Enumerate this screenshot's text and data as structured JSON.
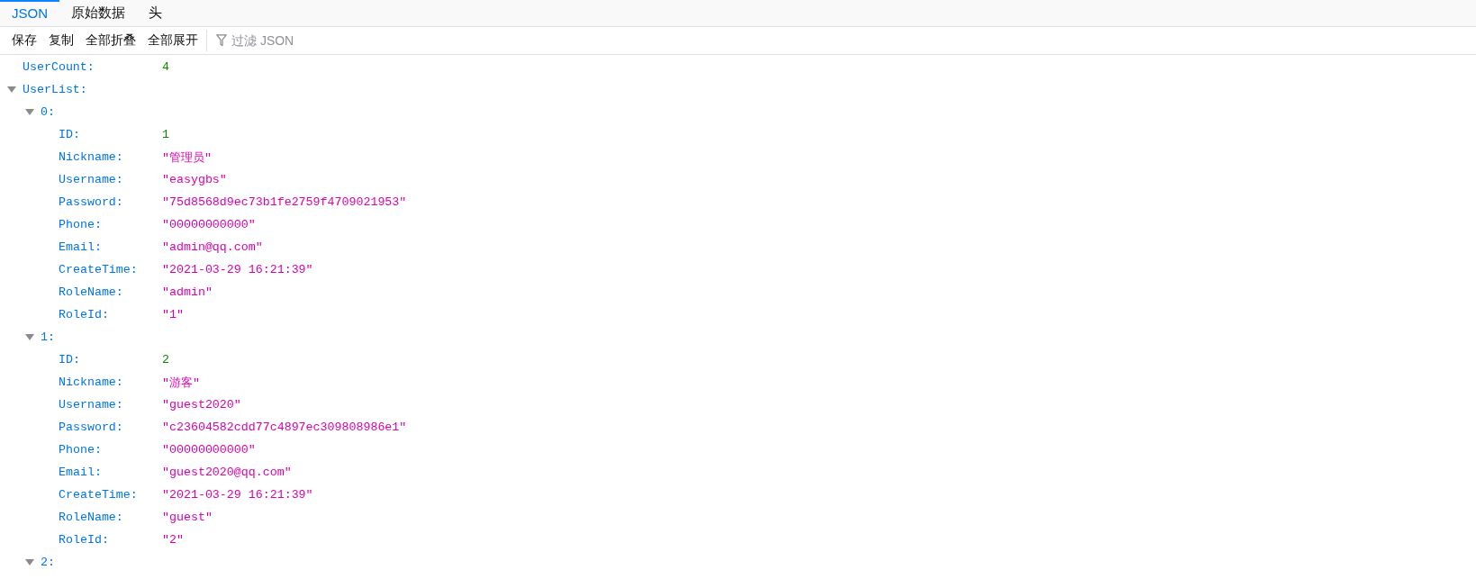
{
  "tabs": [
    {
      "label": "JSON",
      "selected": true
    },
    {
      "label": "原始数据",
      "selected": false
    },
    {
      "label": "头",
      "selected": false
    }
  ],
  "toolbar": {
    "buttons": [
      "保存",
      "复制",
      "全部折叠",
      "全部展开"
    ],
    "filter": {
      "placeholder": "过滤 JSON"
    }
  },
  "tree": [
    {
      "key": "UserCount:",
      "value": "4",
      "kind": "number"
    },
    {
      "key": "UserList:",
      "expanded": true,
      "children": [
        {
          "key": "0:",
          "expanded": true,
          "children": [
            {
              "key": "ID:",
              "value": "1",
              "kind": "number"
            },
            {
              "key": "Nickname:",
              "value": "\"管理员\"",
              "kind": "string"
            },
            {
              "key": "Username:",
              "value": "\"easygbs\"",
              "kind": "string"
            },
            {
              "key": "Password:",
              "value": "\"75d8568d9ec73b1fe2759f4709021953\"",
              "kind": "string"
            },
            {
              "key": "Phone:",
              "value": "\"00000000000\"",
              "kind": "string"
            },
            {
              "key": "Email:",
              "value": "\"admin@qq.com\"",
              "kind": "string"
            },
            {
              "key": "CreateTime:",
              "value": "\"2021-03-29 16:21:39\"",
              "kind": "string"
            },
            {
              "key": "RoleName:",
              "value": "\"admin\"",
              "kind": "string"
            },
            {
              "key": "RoleId:",
              "value": "\"1\"",
              "kind": "string"
            }
          ]
        },
        {
          "key": "1:",
          "expanded": true,
          "children": [
            {
              "key": "ID:",
              "value": "2",
              "kind": "number"
            },
            {
              "key": "Nickname:",
              "value": "\"游客\"",
              "kind": "string"
            },
            {
              "key": "Username:",
              "value": "\"guest2020\"",
              "kind": "string"
            },
            {
              "key": "Password:",
              "value": "\"c23604582cdd77c4897ec309808986e1\"",
              "kind": "string"
            },
            {
              "key": "Phone:",
              "value": "\"00000000000\"",
              "kind": "string"
            },
            {
              "key": "Email:",
              "value": "\"guest2020@qq.com\"",
              "kind": "string"
            },
            {
              "key": "CreateTime:",
              "value": "\"2021-03-29 16:21:39\"",
              "kind": "string"
            },
            {
              "key": "RoleName:",
              "value": "\"guest\"",
              "kind": "string"
            },
            {
              "key": "RoleId:",
              "value": "\"2\"",
              "kind": "string"
            }
          ]
        },
        {
          "key": "2:",
          "expanded": true
        }
      ]
    }
  ]
}
